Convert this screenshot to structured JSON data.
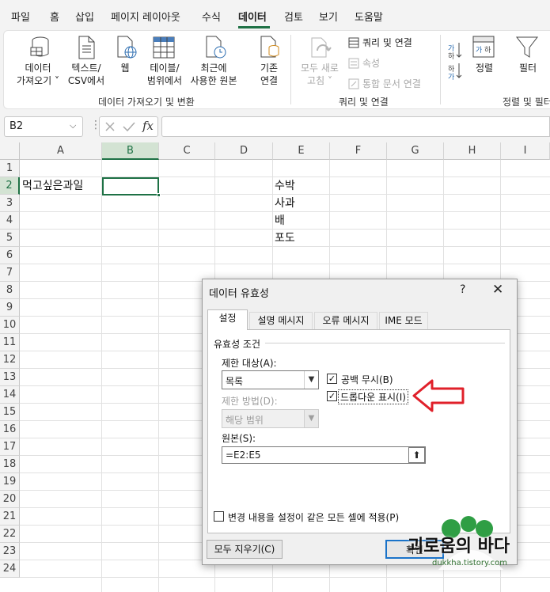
{
  "menu": {
    "items": [
      "파일",
      "홈",
      "삽입",
      "페이지 레이아웃",
      "수식",
      "데이터",
      "검토",
      "보기",
      "도움말"
    ],
    "active": "데이터"
  },
  "ribbon": {
    "get_data": {
      "line1": "데이터",
      "line2": "가져오기 ˅"
    },
    "text_csv": {
      "line1": "텍스트/",
      "line2": "CSV에서"
    },
    "web": {
      "line1": "웹"
    },
    "table_range": {
      "line1": "테이블/",
      "line2": "범위에서"
    },
    "recent": {
      "line1": "최근에",
      "line2": "사용한 원본"
    },
    "existing": {
      "line1": "기존",
      "line2": "연결"
    },
    "group1_label": "데이터 가져오기 및 변환",
    "refresh_all": {
      "line1": "모두 새로",
      "line2": "고침 ˅"
    },
    "queries": "쿼리 및 연결",
    "properties": "속성",
    "edit_links": "통합 문서 연결",
    "group2_label": "쿼리 및 연결",
    "sort": "정렬",
    "filter": "필터",
    "group3_label": "정렬 및 필터"
  },
  "formula_bar": {
    "name_box": "B2",
    "fx": "fx",
    "value": ""
  },
  "sheet": {
    "columns": [
      "A",
      "B",
      "C",
      "D",
      "E",
      "F",
      "G",
      "H",
      "I"
    ],
    "rows": [
      "1",
      "2",
      "3",
      "4",
      "5",
      "6",
      "7",
      "8",
      "9",
      "10",
      "11",
      "12",
      "13",
      "14",
      "15",
      "16",
      "17",
      "18",
      "19",
      "20",
      "21",
      "22",
      "23",
      "24"
    ],
    "selected_cell": "B2",
    "a2": "먹고싶은과일",
    "e_values": [
      "수박",
      "사과",
      "배",
      "포도"
    ]
  },
  "dialog": {
    "title": "데이터 유효성",
    "help": "?",
    "close": "✕",
    "tabs": [
      "설정",
      "설명 메시지",
      "오류 메시지",
      "IME 모드"
    ],
    "active_tab": "설정",
    "criteria_legend": "유효성 조건",
    "allow_label": "제한 대상(A):",
    "allow_value": "목록",
    "ignore_blank": "공백 무시(B)",
    "ignore_blank_checked": true,
    "dropdown": "드롭다운 표시(I)",
    "dropdown_checked": true,
    "data_label": "제한 방법(D):",
    "data_value": "해당 범위",
    "source_label": "원본(S):",
    "source_value": "=E2:E5",
    "apply_all": "변경 내용을 설정이 같은 모든 셀에 적용(P)",
    "apply_all_checked": false,
    "clear_all": "모두 지우기(C)",
    "ok": "확인"
  },
  "watermark": {
    "text": "괴로움의 바다",
    "url": "dukkha.tistory.com"
  },
  "colors": {
    "accent": "#1e7145",
    "arrow": "#e0202a"
  }
}
